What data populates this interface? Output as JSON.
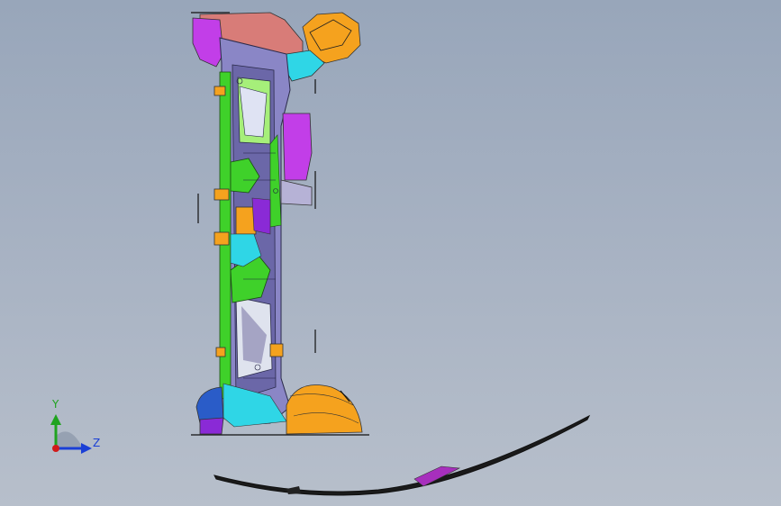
{
  "viewport": {
    "background_top": "#98a6ba",
    "background_bottom": "#b7bfcb"
  },
  "triad": {
    "y_label": "Y",
    "z_label": "Z",
    "y_color": "#1fa31f",
    "z_color": "#1a3fd6",
    "origin_color": "#d11a1a"
  },
  "model": {
    "part_colors": {
      "frame": "#8a86c6",
      "frame_dark": "#6b67a8",
      "green": "#3fd12a",
      "magenta": "#c23ee8",
      "orange": "#f5a21e",
      "salmon": "#d87c78",
      "cyan": "#2fd6e6",
      "blue": "#2a5cc8",
      "purple": "#8a2ad6"
    }
  }
}
